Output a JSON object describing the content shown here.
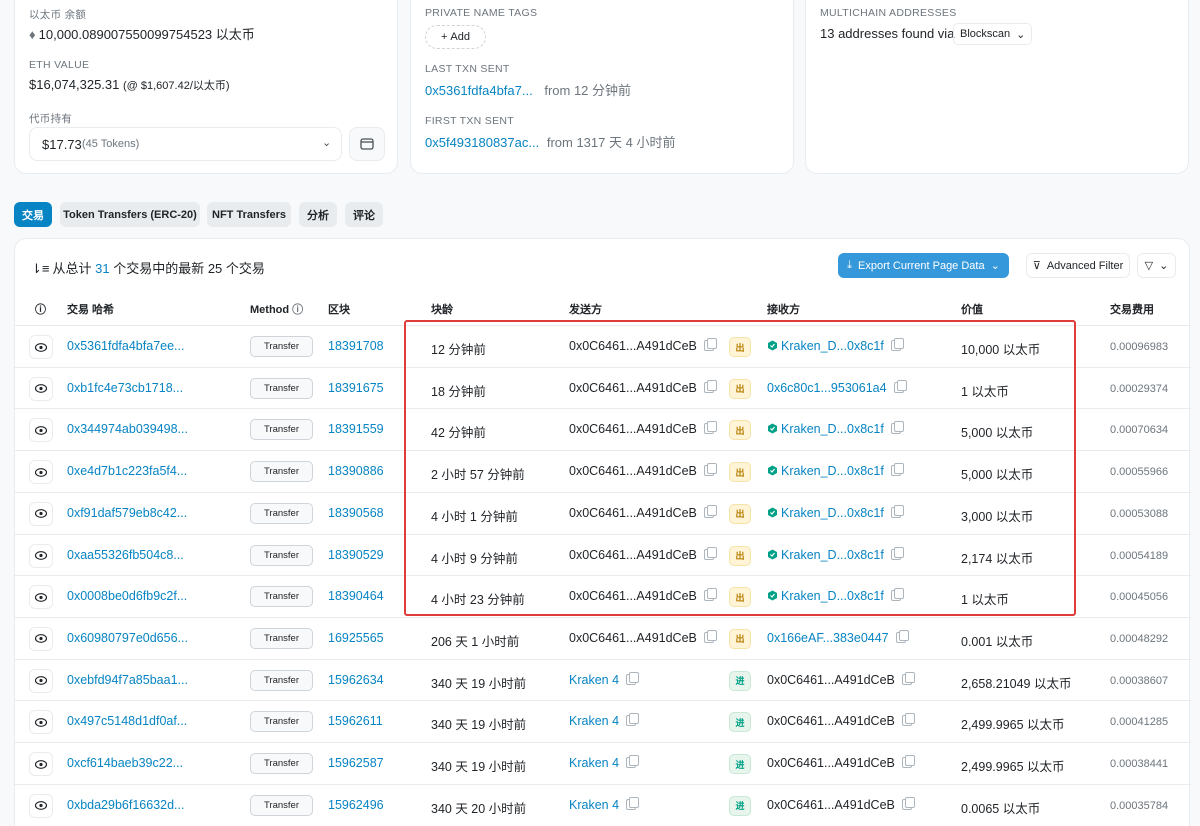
{
  "overview": {
    "balance_label": "以太币 余额",
    "balance_value": "10,000.089007550099754523 以太币",
    "eth_value_label": "ETH VALUE",
    "eth_value": "$16,074,325.31",
    "eth_rate": "(@ $1,607.42/以太币)",
    "token_label": "代币持有",
    "token_value": "$17.73",
    "token_count": "(45 Tokens)"
  },
  "more_info": {
    "private_tags_label": "PRIVATE NAME TAGS",
    "add_label": "Add",
    "last_txn_label": "LAST TXN SENT",
    "last_txn_hash": "0x5361fdfa4bfa7...",
    "last_txn_from": "from 12 分钟前",
    "first_txn_label": "FIRST TXN SENT",
    "first_txn_hash": "0x5f493180837ac...",
    "first_txn_from": "from 1317 天 4 小时前"
  },
  "multichain": {
    "label": "MULTICHAIN ADDRESSES",
    "found_text": "13 addresses found via",
    "dropdown": "Blockscan"
  },
  "tabs": [
    "交易",
    "Token Transfers (ERC-20)",
    "NFT Transfers",
    "分析",
    "评论"
  ],
  "table": {
    "summary_prefix": "从总计",
    "summary_count": "31",
    "summary_suffix": "个交易中的最新 25 个交易",
    "export_label": "Export Current Page Data",
    "advanced_filter_label": "Advanced Filter",
    "headers": {
      "hash": "交易 哈希",
      "method": "Method",
      "block": "区块",
      "age": "块龄",
      "from": "发送方",
      "to": "接收方",
      "value": "价值",
      "fee": "交易费用"
    },
    "rows": [
      {
        "hash": "0x5361fdfa4bfa7ee...",
        "method": "Transfer",
        "block": "18391708",
        "age": "12 分钟前",
        "from": "0x0C6461...A491dCeB",
        "from_link": false,
        "dir": "出",
        "to": "Kraken_D...0x8c1f",
        "to_verified": true,
        "to_link": true,
        "value": "10,000 以太币",
        "fee": "0.00096983"
      },
      {
        "hash": "0xb1fc4e73cb1718...",
        "method": "Transfer",
        "block": "18391675",
        "age": "18 分钟前",
        "from": "0x0C6461...A491dCeB",
        "from_link": false,
        "dir": "出",
        "to": "0x6c80c1...953061a4",
        "to_verified": false,
        "to_link": true,
        "value": "1 以太币",
        "fee": "0.00029374"
      },
      {
        "hash": "0x344974ab039498...",
        "method": "Transfer",
        "block": "18391559",
        "age": "42 分钟前",
        "from": "0x0C6461...A491dCeB",
        "from_link": false,
        "dir": "出",
        "to": "Kraken_D...0x8c1f",
        "to_verified": true,
        "to_link": true,
        "value": "5,000 以太币",
        "fee": "0.00070634"
      },
      {
        "hash": "0xe4d7b1c223fa5f4...",
        "method": "Transfer",
        "block": "18390886",
        "age": "2 小时 57 分钟前",
        "from": "0x0C6461...A491dCeB",
        "from_link": false,
        "dir": "出",
        "to": "Kraken_D...0x8c1f",
        "to_verified": true,
        "to_link": true,
        "value": "5,000 以太币",
        "fee": "0.00055966"
      },
      {
        "hash": "0xf91daf579eb8c42...",
        "method": "Transfer",
        "block": "18390568",
        "age": "4 小时 1 分钟前",
        "from": "0x0C6461...A491dCeB",
        "from_link": false,
        "dir": "出",
        "to": "Kraken_D...0x8c1f",
        "to_verified": true,
        "to_link": true,
        "value": "3,000 以太币",
        "fee": "0.00053088"
      },
      {
        "hash": "0xaa55326fb504c8...",
        "method": "Transfer",
        "block": "18390529",
        "age": "4 小时 9 分钟前",
        "from": "0x0C6461...A491dCeB",
        "from_link": false,
        "dir": "出",
        "to": "Kraken_D...0x8c1f",
        "to_verified": true,
        "to_link": true,
        "value": "2,174 以太币",
        "fee": "0.00054189"
      },
      {
        "hash": "0x0008be0d6fb9c2f...",
        "method": "Transfer",
        "block": "18390464",
        "age": "4 小时 23 分钟前",
        "from": "0x0C6461...A491dCeB",
        "from_link": false,
        "dir": "出",
        "to": "Kraken_D...0x8c1f",
        "to_verified": true,
        "to_link": true,
        "value": "1 以太币",
        "fee": "0.00045056"
      },
      {
        "hash": "0x60980797e0d656...",
        "method": "Transfer",
        "block": "16925565",
        "age": "206 天 1 小时前",
        "from": "0x0C6461...A491dCeB",
        "from_link": false,
        "dir": "出",
        "to": "0x166eAF...383e0447",
        "to_verified": false,
        "to_link": true,
        "value": "0.001 以太币",
        "fee": "0.00048292"
      },
      {
        "hash": "0xebfd94f7a85baa1...",
        "method": "Transfer",
        "block": "15962634",
        "age": "340 天 19 小时前",
        "from": "Kraken 4",
        "from_link": true,
        "dir": "进",
        "to": "0x0C6461...A491dCeB",
        "to_verified": false,
        "to_link": false,
        "value": "2,658.21049 以太币",
        "fee": "0.00038607"
      },
      {
        "hash": "0x497c5148d1df0af...",
        "method": "Transfer",
        "block": "15962611",
        "age": "340 天 19 小时前",
        "from": "Kraken 4",
        "from_link": true,
        "dir": "进",
        "to": "0x0C6461...A491dCeB",
        "to_verified": false,
        "to_link": false,
        "value": "2,499.9965 以太币",
        "fee": "0.00041285"
      },
      {
        "hash": "0xcf614baeb39c22...",
        "method": "Transfer",
        "block": "15962587",
        "age": "340 天 19 小时前",
        "from": "Kraken 4",
        "from_link": true,
        "dir": "进",
        "to": "0x0C6461...A491dCeB",
        "to_verified": false,
        "to_link": false,
        "value": "2,499.9965 以太币",
        "fee": "0.00038441"
      },
      {
        "hash": "0xbda29b6f16632d...",
        "method": "Transfer",
        "block": "15962496",
        "age": "340 天 20 小时前",
        "from": "Kraken 4",
        "from_link": true,
        "dir": "进",
        "to": "0x0C6461...A491dCeB",
        "to_verified": false,
        "to_link": false,
        "value": "0.0065 以太币",
        "fee": "0.00035784"
      }
    ]
  },
  "colors": {
    "link": "#0784c3",
    "accent": "#3498db",
    "highlight": "#e03c3c",
    "out_badge": "#fff4d6",
    "in_badge": "#e7f5ec"
  }
}
